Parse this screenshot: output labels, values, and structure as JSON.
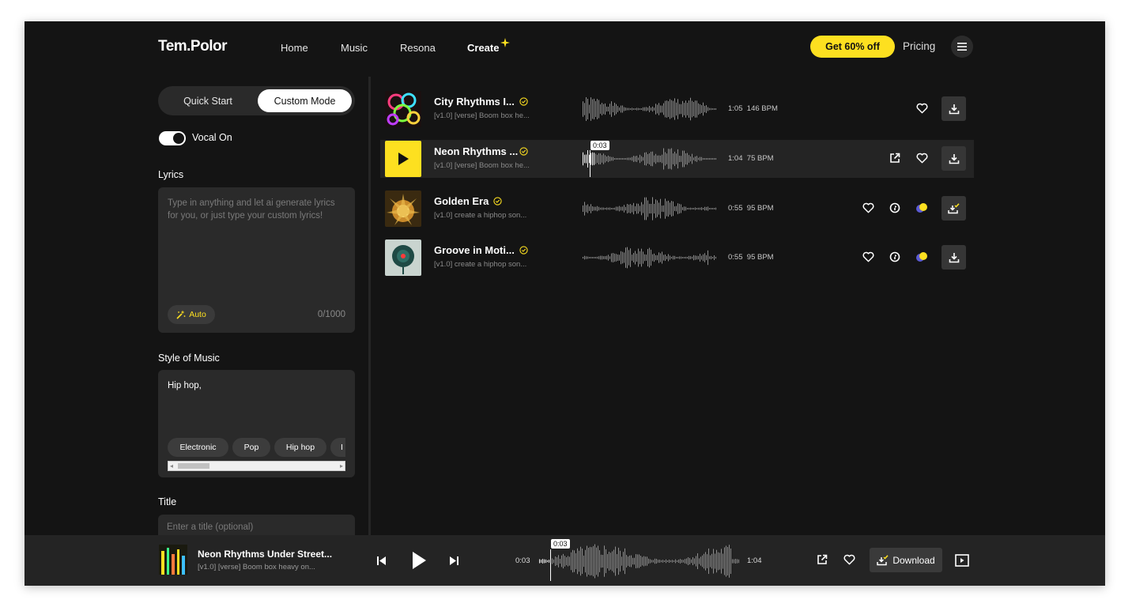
{
  "header": {
    "logo": "Tem.Polor",
    "nav": [
      "Home",
      "Music",
      "Resona",
      "Create"
    ],
    "promo_label": "Get 60% off",
    "pricing_label": "Pricing"
  },
  "create_panel": {
    "modes": [
      "Quick Start",
      "Custom Mode"
    ],
    "active_mode": "Custom Mode",
    "vocal_label": "Vocal On",
    "vocal_on": true,
    "lyrics_label": "Lyrics",
    "lyrics_placeholder": "Type in anything and let ai generate lyrics for you, or just type your custom lyrics!",
    "auto_label": "Auto",
    "lyrics_counter": "0/1000",
    "style_label": "Style of Music",
    "style_value": "Hip hop,",
    "style_chips": [
      "Electronic",
      "Pop",
      "Hip hop",
      "I"
    ],
    "title_label": "Title",
    "title_placeholder": "Enter a title (optional)"
  },
  "tracks": [
    {
      "title": "City Rhythms I...",
      "subtitle": "[v1.0] [verse] Boom box he...",
      "duration": "1:05",
      "bpm": "146 BPM"
    },
    {
      "title": "Neon Rhythms ...",
      "subtitle": "[v1.0] [verse] Boom box he...",
      "duration": "1:04",
      "bpm": "75 BPM",
      "progress_label": "0:03"
    },
    {
      "title": "Golden Era",
      "subtitle": "[v1.0] create a hiphop son...",
      "duration": "0:55",
      "bpm": "95 BPM"
    },
    {
      "title": "Groove in Moti...",
      "subtitle": "[v1.0] create a hiphop son...",
      "duration": "0:55",
      "bpm": "95 BPM"
    }
  ],
  "player": {
    "title": "Neon Rhythms Under Street...",
    "subtitle": "[v1.0] [verse] Boom box heavy on...",
    "elapsed": "0:03",
    "progress_tag": "0:03",
    "total": "1:04",
    "download_label": "Download"
  },
  "colors": {
    "accent": "#fde020",
    "background": "#141414",
    "panel": "#2a2a2a"
  }
}
